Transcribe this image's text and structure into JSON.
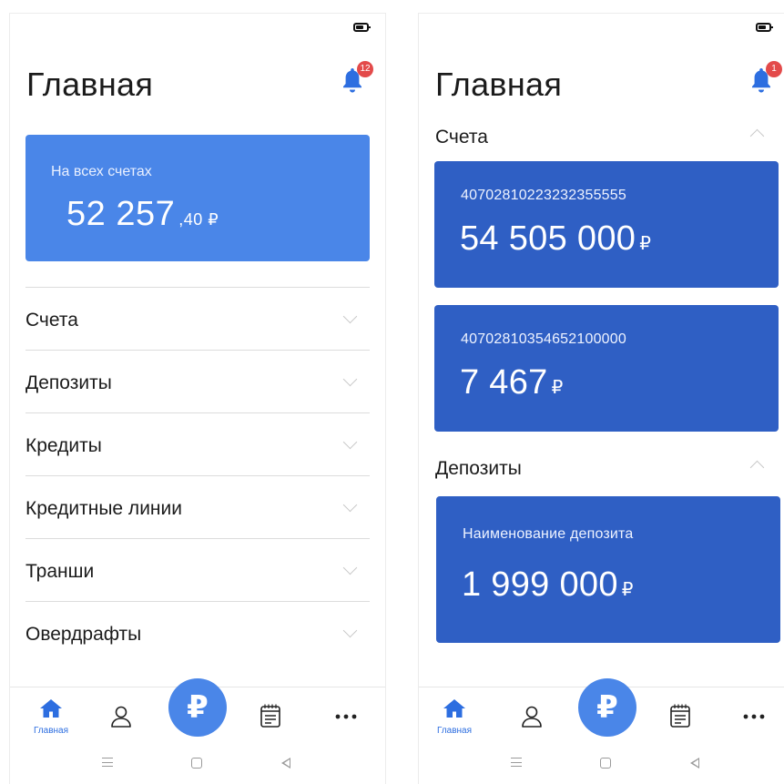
{
  "colors": {
    "accent": "#4a86e8",
    "card_dark": "#2f5fc4",
    "badge": "#e34a4a",
    "tab_active": "#2d6ee0"
  },
  "screen_a": {
    "title": "Главная",
    "notifications_badge": "12",
    "total_card": {
      "label": "На всех счетах",
      "amount": "52 257",
      "kopecks": ",40 ₽"
    },
    "sections": [
      "Счета",
      "Депозиты",
      "Кредиты",
      "Кредитные линии",
      "Транши",
      "Овердрафты"
    ]
  },
  "screen_b": {
    "title": "Главная",
    "notifications_badge": "1",
    "accounts_header": "Счета",
    "accounts": [
      {
        "number": "40702810223232355555",
        "amount": "54 505 000",
        "currency": "₽"
      },
      {
        "number": "40702810354652100000",
        "amount": "7 467",
        "currency": "₽"
      }
    ],
    "deposits_header": "Депозиты",
    "deposits": [
      {
        "name": "Наименование депозита",
        "amount": "1 999 000",
        "currency": "₽"
      }
    ]
  },
  "tabbar": {
    "home_label": "Главная",
    "icons": [
      "home-icon",
      "profile-icon",
      "ruble-icon",
      "calendar-icon",
      "more-icon"
    ],
    "ruble_symbol": "₽"
  },
  "android_nav": {
    "icons": [
      "menu-icon",
      "home-square-icon",
      "back-icon"
    ]
  }
}
